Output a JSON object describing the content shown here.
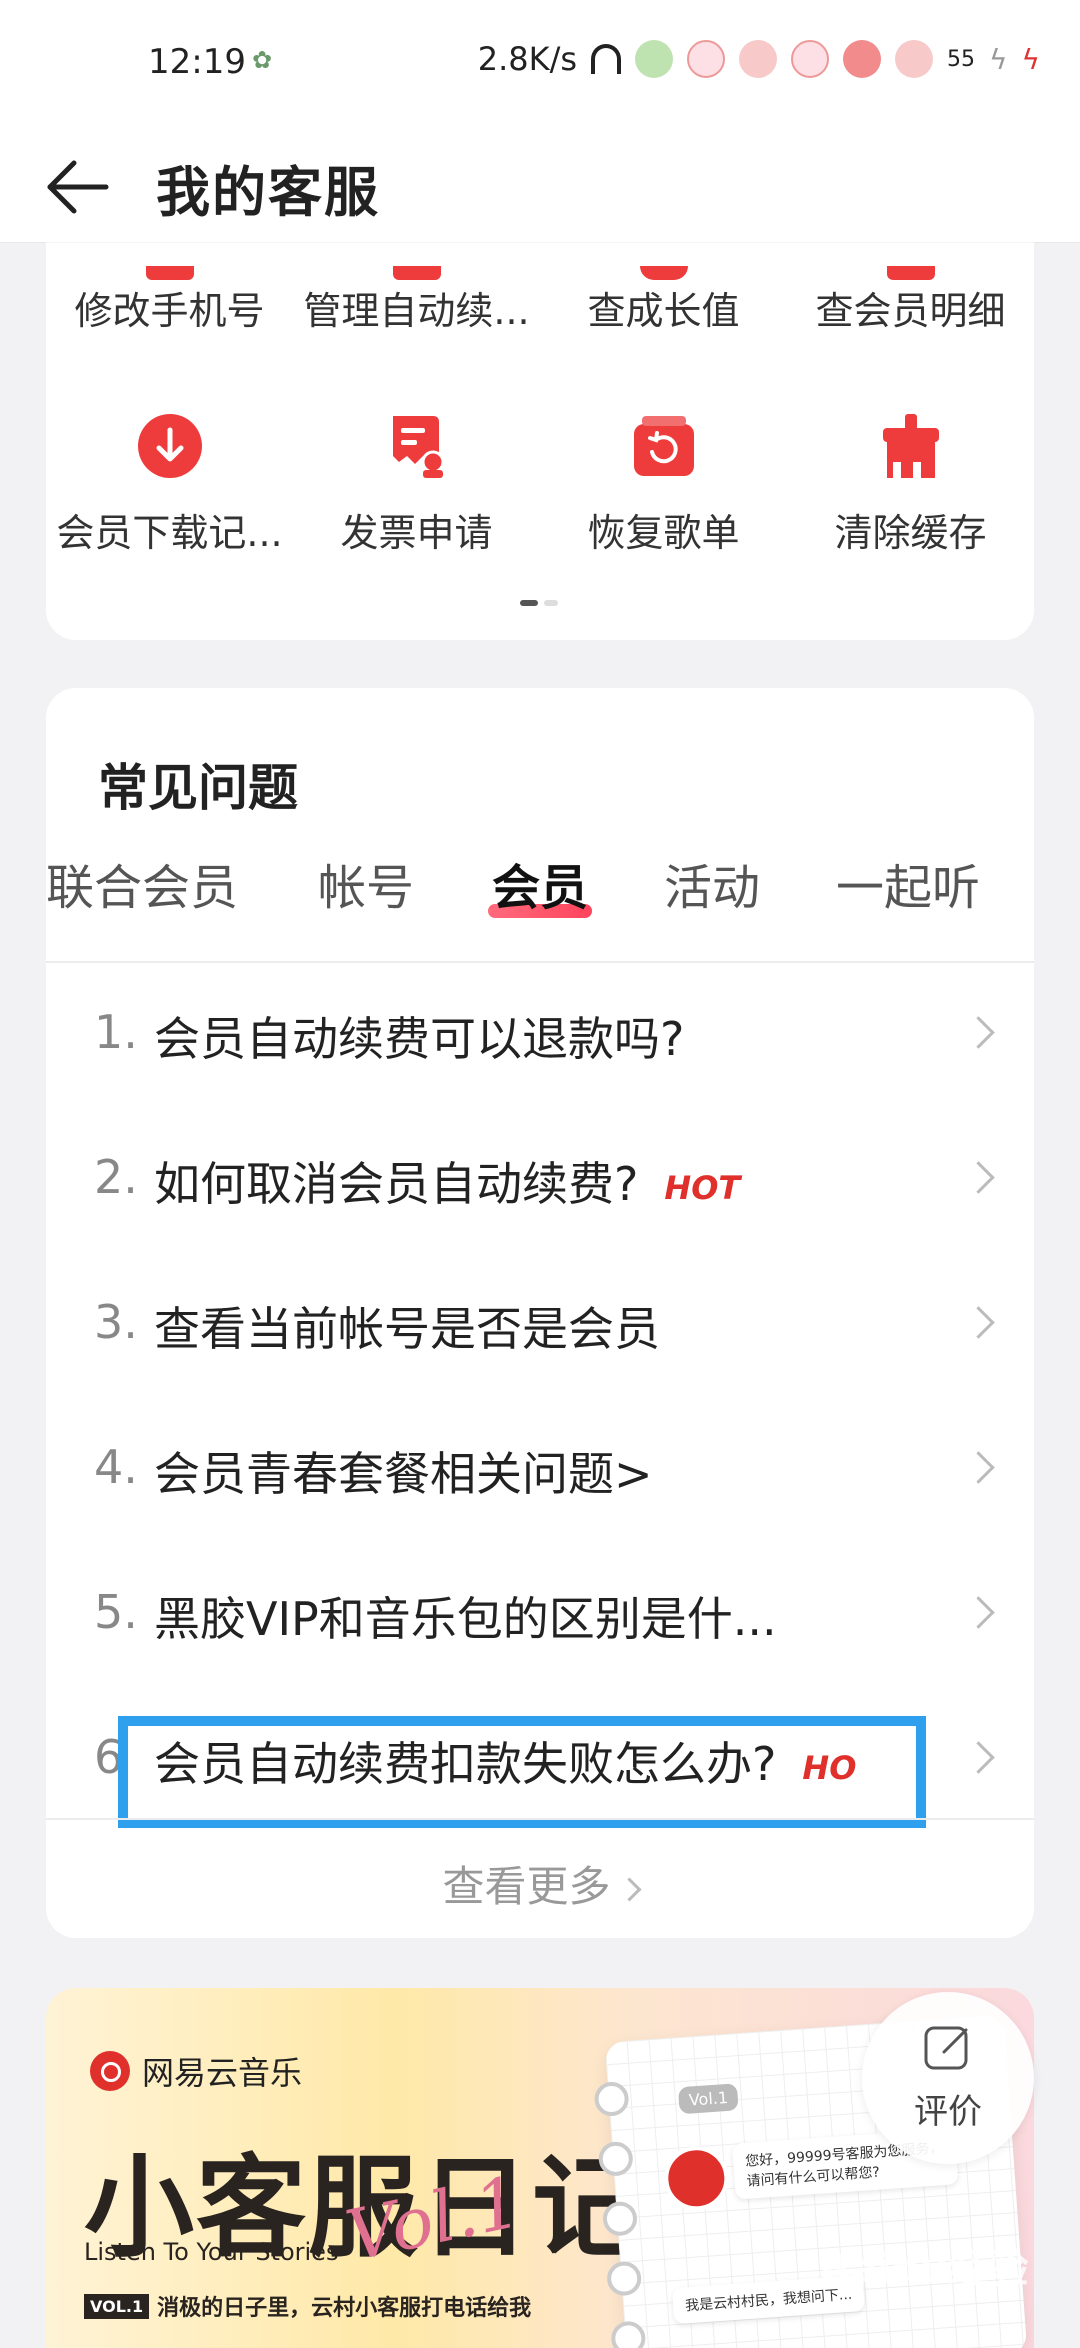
{
  "status_bar": {
    "time": "12:19",
    "net_speed": "2.8K/s",
    "battery": "55"
  },
  "header": {
    "title": "我的客服"
  },
  "services": {
    "row1": [
      {
        "label": "修改手机号",
        "icon": "phone-icon"
      },
      {
        "label": "管理自动续...",
        "icon": "auto-renew-icon"
      },
      {
        "label": "查成长值",
        "icon": "growth-icon"
      },
      {
        "label": "查会员明细",
        "icon": "member-detail-icon"
      }
    ],
    "row2": [
      {
        "label": "会员下载记...",
        "icon": "download-icon"
      },
      {
        "label": "发票申请",
        "icon": "invoice-icon"
      },
      {
        "label": "恢复歌单",
        "icon": "restore-playlist-icon"
      },
      {
        "label": "清除缓存",
        "icon": "clear-cache-icon"
      }
    ]
  },
  "faq": {
    "title": "常见问题",
    "tabs": [
      "联合会员",
      "帐号",
      "会员",
      "活动",
      "一起听"
    ],
    "active_tab": "会员",
    "items": [
      {
        "num": "1.",
        "question": "会员自动续费可以退款吗?",
        "hot": ""
      },
      {
        "num": "2.",
        "question": "如何取消会员自动续费?",
        "hot": "HOT"
      },
      {
        "num": "3.",
        "question": "查看当前帐号是否是会员",
        "hot": ""
      },
      {
        "num": "4.",
        "question": "会员青春套餐相关问题>",
        "hot": ""
      },
      {
        "num": "5.",
        "question": "黑胶VIP和音乐包的区别是什...",
        "hot": ""
      },
      {
        "num": "6",
        "question": "会员自动续费扣款失败怎么办?",
        "hot": "HO"
      }
    ],
    "more_label": "查看更多"
  },
  "banner": {
    "brand": "网易云音乐",
    "headline": "小客服日记",
    "script": "Vol.1",
    "tagline": "Listen To Your Stories",
    "vol_tag": "VOL.1",
    "slogan": "消极的日子里，云村小客服打电话给我",
    "notebook_vol": "Vol.1",
    "bubble1": "您好，99999号客服为您服务，",
    "bubble2": "请问有什么可以帮您?",
    "bubble3": "我是云村村民，我想问下..."
  },
  "rate_button": {
    "label": "评价"
  },
  "watermark": "Baidu经验",
  "colors": {
    "accent_red": "#ee3c3c",
    "highlight_blue": "#2fa0ee"
  }
}
